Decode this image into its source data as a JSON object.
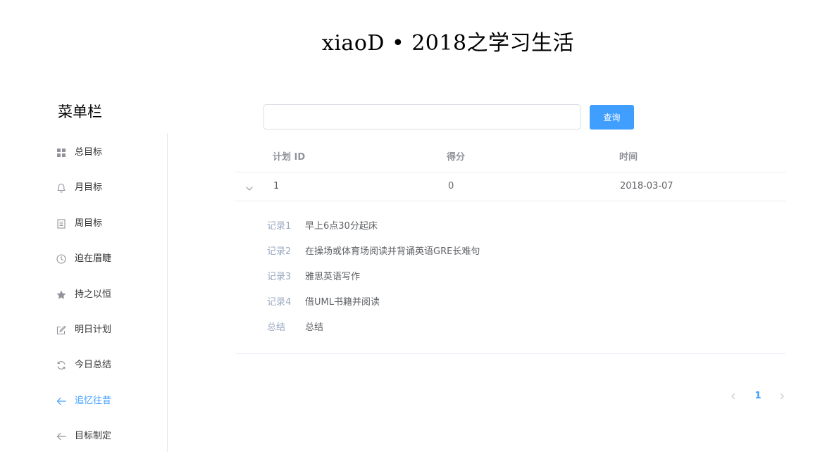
{
  "title": "xiaoD • 2018之学习生活",
  "sidebar": {
    "title": "菜单栏",
    "items": [
      {
        "label": "总目标",
        "icon": "grid-icon"
      },
      {
        "label": "月目标",
        "icon": "bell-icon"
      },
      {
        "label": "周目标",
        "icon": "document-icon"
      },
      {
        "label": "迫在眉睫",
        "icon": "clock-icon"
      },
      {
        "label": "持之以恒",
        "icon": "star-icon"
      },
      {
        "label": "明日计划",
        "icon": "edit-icon"
      },
      {
        "label": "今日总结",
        "icon": "refresh-icon"
      },
      {
        "label": "追忆往昔",
        "icon": "arrow-left-icon",
        "active": true
      },
      {
        "label": "目标制定",
        "icon": "arrow-left-icon"
      }
    ]
  },
  "search": {
    "value": "",
    "button_label": "查询"
  },
  "table": {
    "headers": [
      "计划 ID",
      "得分",
      "时间"
    ],
    "rows": [
      {
        "id": "1",
        "score": "0",
        "time": "2018-03-07",
        "expanded": true,
        "details": [
          {
            "key": "记录1",
            "value": "早上6点30分起床"
          },
          {
            "key": "记录2",
            "value": "在操场或体育场阅读并背诵英语GRE长难句"
          },
          {
            "key": "记录3",
            "value": "雅思英语写作"
          },
          {
            "key": "记录4",
            "value": "借UML书籍并阅读"
          },
          {
            "key": "总结",
            "value": "总结"
          }
        ]
      }
    ]
  },
  "pagination": {
    "current_page": "1"
  },
  "colors": {
    "accent": "#409eff",
    "text": "#606266",
    "muted": "#909399",
    "detail_key": "#99a9bf",
    "border": "#ebeef5"
  }
}
